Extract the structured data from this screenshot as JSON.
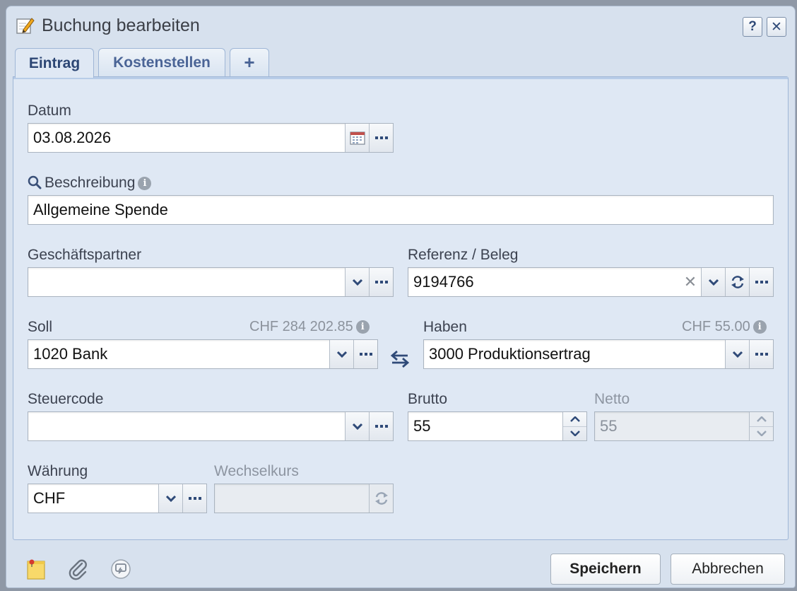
{
  "dialog": {
    "title": "Buchung bearbeiten",
    "help_label": "?",
    "close_label": "✕"
  },
  "tabs": [
    {
      "label": "Eintrag",
      "active": true
    },
    {
      "label": "Kostenstellen",
      "active": false
    },
    {
      "label": "+",
      "active": false
    }
  ],
  "form": {
    "datum": {
      "label": "Datum",
      "value": "03.08.2026"
    },
    "beschreibung": {
      "label": "Beschreibung",
      "value": "Allgemeine Spende"
    },
    "geschaeftspartner": {
      "label": "Geschäftspartner",
      "value": ""
    },
    "referenz": {
      "label": "Referenz / Beleg",
      "value": "9194766"
    },
    "soll": {
      "label": "Soll",
      "balance": "CHF 284 202.85",
      "value": "1020 Bank"
    },
    "haben": {
      "label": "Haben",
      "balance": "CHF 55.00",
      "value": "3000 Produktionsertrag"
    },
    "steuercode": {
      "label": "Steuercode",
      "value": ""
    },
    "brutto": {
      "label": "Brutto",
      "value": "55"
    },
    "netto": {
      "label": "Netto",
      "value": "55"
    },
    "waehrung": {
      "label": "Währung",
      "value": "CHF"
    },
    "wechselkurs": {
      "label": "Wechselkurs",
      "value": ""
    }
  },
  "info_glyph": "i",
  "clear_glyph": "✕",
  "actions": {
    "save_label": "Speichern",
    "cancel_label": "Abbrechen"
  },
  "colors": {
    "accent": "#2f4a78",
    "dialog_bg": "#d7e1ee",
    "panel_bg": "#dfe8f4"
  }
}
